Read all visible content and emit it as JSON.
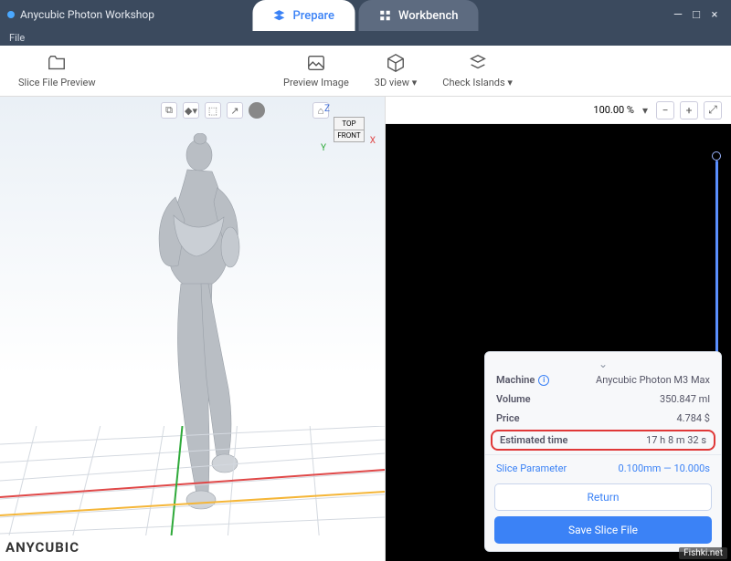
{
  "window": {
    "title": "Anycubic Photon Workshop",
    "menu_file": "File"
  },
  "tabs": {
    "prepare": "Prepare",
    "workbench": "Workbench"
  },
  "ribbon": {
    "slice_preview": "Slice File Preview",
    "preview_image": "Preview Image",
    "view3d": "3D view ▾",
    "check_islands": "Check Islands ▾"
  },
  "orient": {
    "top": "TOP",
    "front": "FRONT",
    "z": "Z",
    "y": "Y",
    "x": "X"
  },
  "brand": "ANYCUBIC",
  "zoom": {
    "pct": "100.00 %"
  },
  "info": {
    "machine_label": "Machine",
    "machine_value": "Anycubic Photon M3 Max",
    "volume_label": "Volume",
    "volume_value": "350.847 ml",
    "price_label": "Price",
    "price_value": "4.784 $",
    "time_label": "Estimated time",
    "time_value": "17 h 8 m 32 s",
    "slice_param_label": "Slice Parameter",
    "slice_param_value": "0.100mm — 10.000s",
    "return_btn": "Return",
    "save_btn": "Save Slice File"
  },
  "watermark": "Fishki.net"
}
